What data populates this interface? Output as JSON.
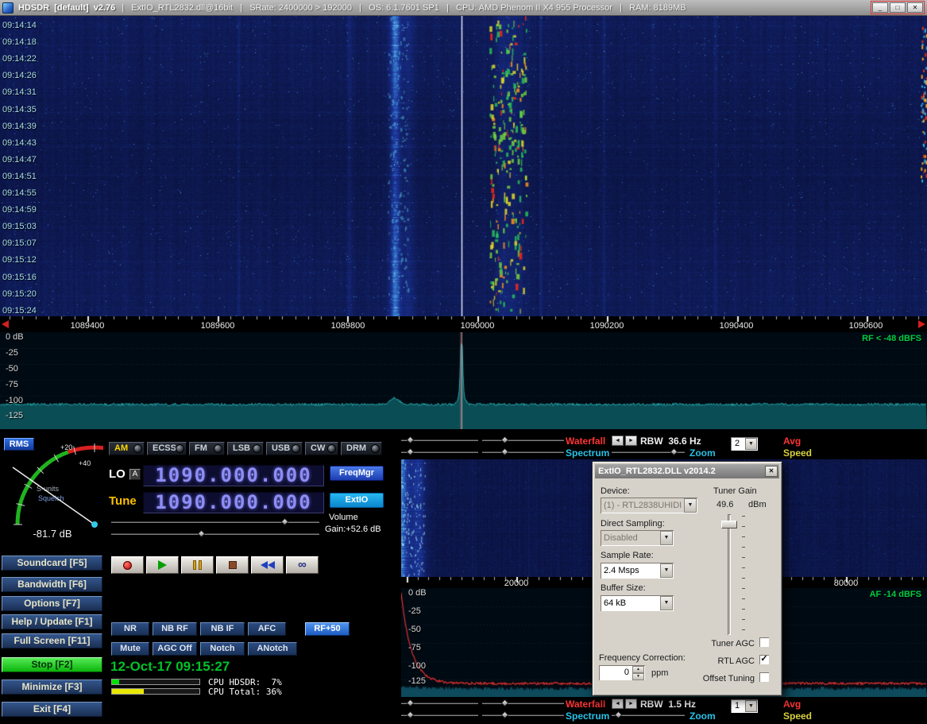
{
  "titlebar": {
    "title": "HDSDR  [default]  v2.76",
    "info": "|   ExtIO_RTL2832.dll@16bit   |   SRate: 2400000 > 192000   |   OS: 6.1.7601 SP1   |   CPU: AMD Phenom II X4 955 Processor   |   RAM: 8189MB",
    "minimize_glyph": "_",
    "maximize_glyph": "□",
    "close_glyph": "✕"
  },
  "waterfall": {
    "timestamps": [
      "09:14:14",
      "09:14:18",
      "09:14:22",
      "09:14:26",
      "09:14:31",
      "09:14:35",
      "09:14:39",
      "09:14:43",
      "09:14:47",
      "09:14:51",
      "09:14:55",
      "09:14:59",
      "09:15:03",
      "09:15:07",
      "09:15:12",
      "09:15:16",
      "09:15:20",
      "09:15:24"
    ]
  },
  "freq_scale": {
    "labels": [
      "1089400",
      "1089600",
      "1089800",
      "1090000",
      "1090200",
      "1090400",
      "1090600"
    ]
  },
  "rf_display": {
    "db_labels": [
      "0 dB",
      "-25",
      "-50",
      "-75",
      "-100",
      "-125"
    ],
    "level_text": "RF < -48 dBFS"
  },
  "smeter": {
    "mode_button": "RMS",
    "tick_plus20": "+20",
    "tick_plus40": "+40",
    "sunits_label": "S-units",
    "squelch_label": "Squelch",
    "value_text": "-81.7 dB"
  },
  "menu_buttons": [
    "Soundcard [F5]",
    "Bandwidth [F6]",
    "Options [F7]",
    "Help / Update [F1]",
    "Full Screen [F11]",
    "Stop [F2]",
    "Minimize [F3]",
    "Exit [F4]"
  ],
  "mode_buttons": [
    "AM",
    "ECSS",
    "FM",
    "LSB",
    "USB",
    "CW",
    "DRM"
  ],
  "tuning": {
    "lo_label": "LO",
    "lo_channel": "A",
    "lo_frequency": "1090.000.000",
    "tune_label": "Tune",
    "tune_frequency": "1090.000.000",
    "freqmgr_button": "FreqMgr",
    "extio_button": "ExtIO",
    "volume_label": "Volume",
    "gain_text": "Gain:+52.6 dB"
  },
  "transport": {
    "loop_glyph": "∞"
  },
  "dsp_buttons": {
    "row1": [
      "NR",
      "NB RF",
      "NB IF",
      "AFC",
      "RF+50"
    ],
    "row2": [
      "Mute",
      "AGC Off",
      "Notch",
      "ANotch"
    ]
  },
  "status": {
    "datetime": "12-Oct-17 09:15:27",
    "cpu_hdsdr": "CPU HDSDR:  7%",
    "cpu_total": "CPU Total: 36%"
  },
  "rf_controls": {
    "waterfall_label": "Waterfall",
    "spectrum_label": "Spectrum",
    "rbw_text": "RBW  36.6 Hz",
    "avg_value": "2",
    "avg_label": "Avg",
    "zoom_label": "Zoom",
    "speed_label": "Speed"
  },
  "af_controls": {
    "waterfall_label": "Waterfall",
    "spectrum_label": "Spectrum",
    "rbw_text": "RBW  1.5 Hz",
    "avg_value": "1",
    "avg_label": "Avg",
    "zoom_label": "Zoom",
    "speed_label": "Speed"
  },
  "af_display": {
    "db_labels": [
      "0 dB",
      "-25",
      "-50",
      "-75",
      "-100",
      "-125"
    ],
    "level_text": "AF -14 dBFS",
    "freq_labels": [
      "20000",
      "80000"
    ]
  },
  "extio_dialog": {
    "title": "ExtIO_RTL2832.DLL v2014.2",
    "device_label": "Device:",
    "device_value": "(1) - RTL2838UHIDI",
    "tuner_gain_label": "Tuner Gain",
    "tuner_gain_value": "49.6",
    "tuner_gain_unit": "dBm",
    "direct_sampling_label": "Direct Sampling:",
    "direct_sampling_value": "Disabled",
    "sample_rate_label": "Sample Rate:",
    "sample_rate_value": "2.4 Msps",
    "buffer_size_label": "Buffer Size:",
    "buffer_size_value": "64 kB",
    "tuner_agc_label": "Tuner AGC",
    "rtl_agc_label": "RTL AGC",
    "offset_tuning_label": "Offset Tuning",
    "freq_correction_label": "Frequency Correction:",
    "freq_correction_value": "0",
    "ppm_label": "ppm"
  },
  "icons": {
    "left_arrow": "◄",
    "right_arrow": "►",
    "down_arrow": "▼",
    "up_arrow": "▲",
    "check": "✓"
  },
  "colors": {
    "accent_blue": "#1c5cc0",
    "waterfall_label_red": "#ff3434",
    "spectrum_label_cyan": "#27c3e8",
    "speed_label_yellow": "#d8d23c",
    "datetime_green": "#00c228",
    "stop_green": "#0cb40c",
    "level_green": "#00cc44"
  }
}
